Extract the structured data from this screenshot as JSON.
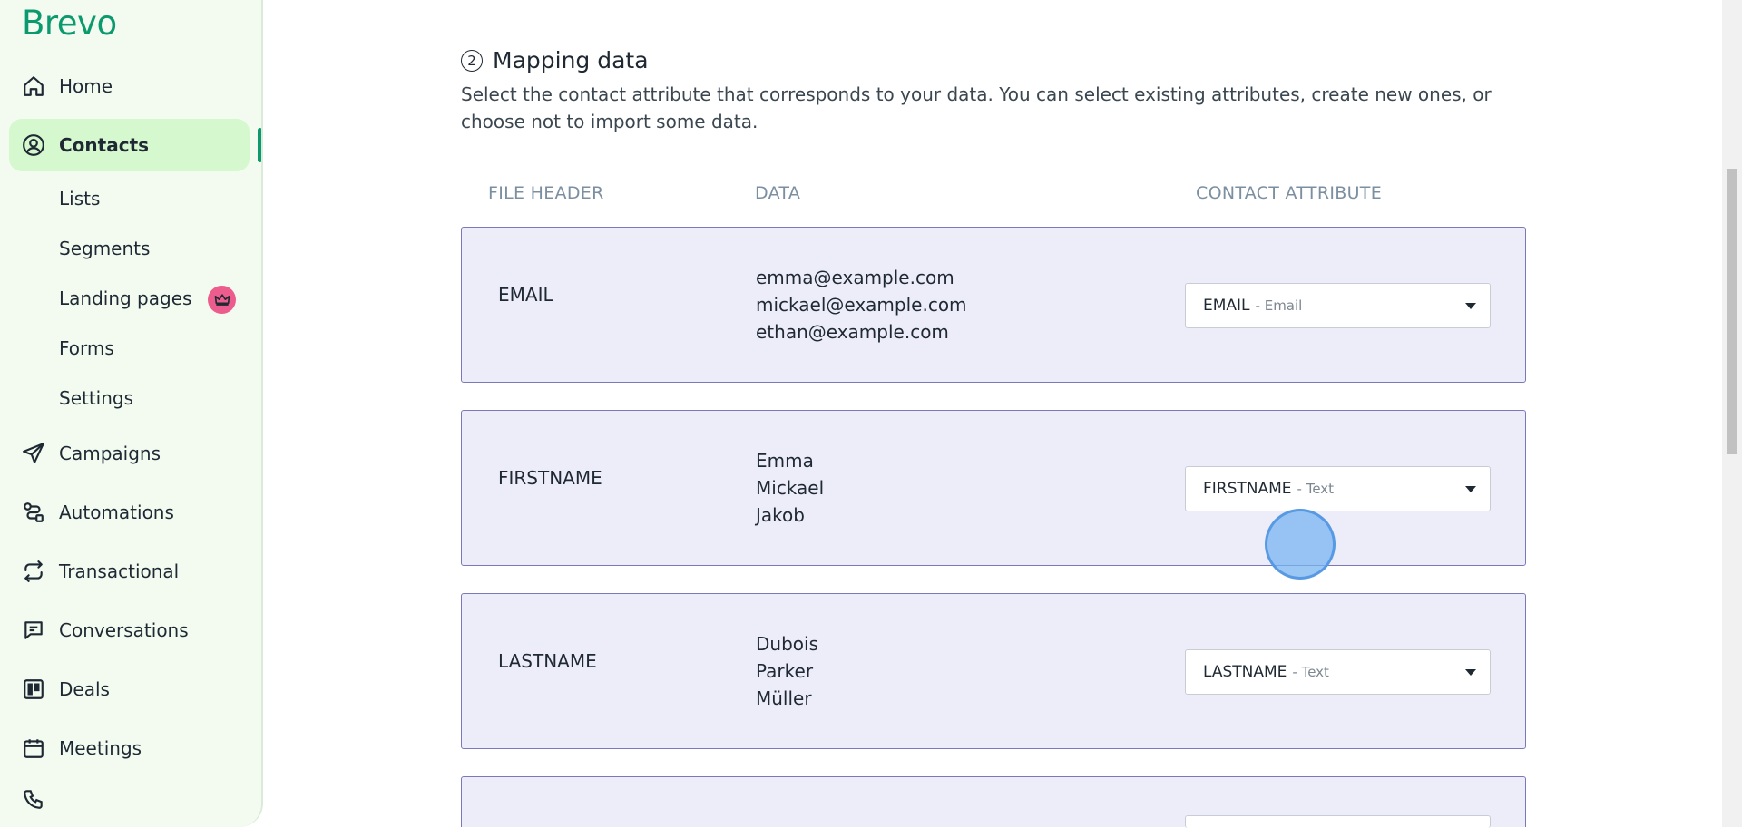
{
  "brand": {
    "logo_text": "Brevo",
    "accent": "#0b996e"
  },
  "sidebar": {
    "items": [
      {
        "label": "Home",
        "icon": "home-icon"
      },
      {
        "label": "Contacts",
        "icon": "contacts-icon",
        "active": true
      },
      {
        "label": "Campaigns",
        "icon": "send-icon"
      },
      {
        "label": "Automations",
        "icon": "automations-icon"
      },
      {
        "label": "Transactional",
        "icon": "transactional-icon"
      },
      {
        "label": "Conversations",
        "icon": "chat-icon"
      },
      {
        "label": "Deals",
        "icon": "deals-icon"
      },
      {
        "label": "Meetings",
        "icon": "calendar-icon"
      }
    ],
    "contacts_sub": [
      {
        "label": "Lists"
      },
      {
        "label": "Segments"
      },
      {
        "label": "Landing pages",
        "badge": "crown-icon"
      },
      {
        "label": "Forms"
      },
      {
        "label": "Settings"
      }
    ]
  },
  "mapping": {
    "step_number": "2",
    "title": "Mapping data",
    "description": "Select the contact attribute that corresponds to your data. You can select existing attributes, create new ones, or choose not to import some data.",
    "columns": {
      "file_header": "FILE HEADER",
      "data": "DATA",
      "contact_attribute": "CONTACT ATTRIBUTE"
    },
    "rows": [
      {
        "header": "EMAIL",
        "data": [
          "emma@example.com",
          "mickael@example.com",
          "ethan@example.com"
        ],
        "attribute": "EMAIL",
        "attribute_type": "- Email"
      },
      {
        "header": "FIRSTNAME",
        "data": [
          "Emma",
          "Mickael",
          "Jakob"
        ],
        "attribute": "FIRSTNAME",
        "attribute_type": "- Text"
      },
      {
        "header": "LASTNAME",
        "data": [
          "Dubois",
          "Parker",
          "Müller"
        ],
        "attribute": "LASTNAME",
        "attribute_type": "- Text"
      }
    ]
  }
}
